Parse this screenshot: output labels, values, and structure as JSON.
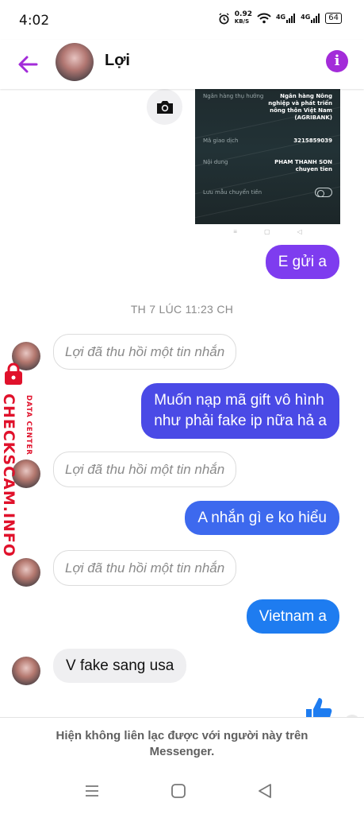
{
  "status_bar": {
    "time": "4:02",
    "net_speed_value": "0.92",
    "net_speed_unit": "KB/S",
    "signal_1": "4G",
    "signal_2": "4G",
    "battery": "64"
  },
  "header": {
    "contact_name": "Lợi",
    "accent_color": "#a32cd9"
  },
  "transfer_screenshot": {
    "rows": [
      {
        "label": "Ngân hàng thụ hưởng",
        "value": "Ngân hàng Nông nghiệp và phát triển nông thôn Việt Nam (AGRIBANK)"
      },
      {
        "label": "Mã giao dịch",
        "value": "3215859039"
      },
      {
        "label": "Nội dung",
        "value": "PHAM THANH SON chuyen tien"
      },
      {
        "label": "Lưu mẫu chuyển tiền",
        "value": ""
      }
    ],
    "bank_lines": [
      "Ngân hàng Nông",
      "nghiệp và phát triển",
      "nông thôn Việt Nam",
      "(AGRIBANK)"
    ],
    "content_lines": [
      "PHAM THANH SON",
      "chuyen tien"
    ],
    "nav_glyphs": [
      "≡",
      "▢",
      "◁"
    ]
  },
  "messages": {
    "m1": "E gửi a",
    "timestamp": "TH 7 LÚC 11:23 CH",
    "unsent": "Lợi đã thu hồi một tin nhắn",
    "m2_line1": "Muốn nạp mã gift vô hình",
    "m2_line2": "như phải fake ip nữa hả a",
    "m3": "A nhắn gì e ko hiểu",
    "m4": "Vietnam a",
    "m5": "V fake sang usa"
  },
  "watermark": {
    "main": "CHECKSCAM.INFO",
    "sub": "DATA CENTER"
  },
  "notice": {
    "line1": "Hiện không liên lạc được với người này trên",
    "line2": "Messenger."
  }
}
